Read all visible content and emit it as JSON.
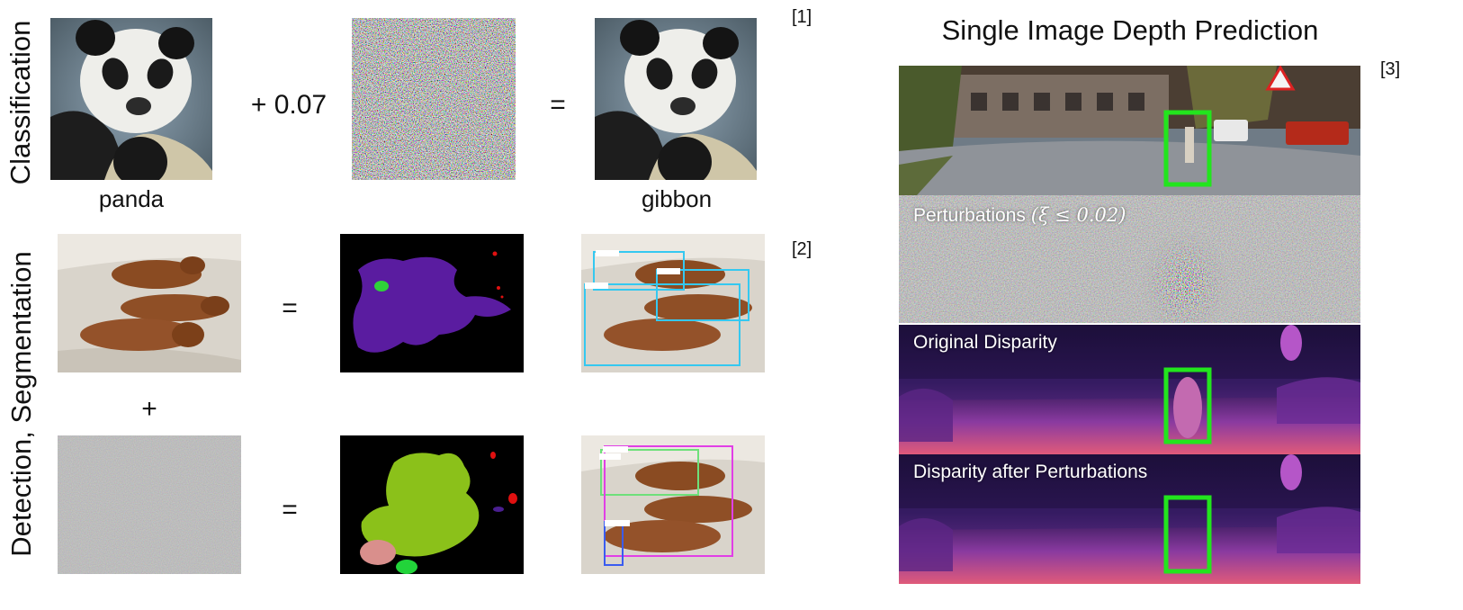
{
  "left": {
    "row_label_top": "Classification",
    "row_label_bottom": "Detection, Segmentation",
    "classification": {
      "input_caption": "panda",
      "operator_plus": "+ 0.07",
      "operator_equals": "=",
      "output_caption": "gibbon",
      "ref": "[1]"
    },
    "detection": {
      "equals_top": "=",
      "plus_middle": "+",
      "equals_bottom": "=",
      "ref": "[2]"
    }
  },
  "right": {
    "title": "Single Image Depth Prediction",
    "ref": "[3]",
    "panels": {
      "perturbations_label": "Perturbations",
      "perturbations_math": "(ξ ≤ 0.02)",
      "original_label": "Original Disparity",
      "after_label": "Disparity after Perturbations"
    }
  },
  "colors": {
    "bbox_green": "#22e51d",
    "seg_purple": "#5a1ca0",
    "seg_green": "#8bc11a",
    "det_cyan": "#35c8f0",
    "det_magenta": "#e13fe6",
    "disparity_dark": "#1c0f3a"
  }
}
